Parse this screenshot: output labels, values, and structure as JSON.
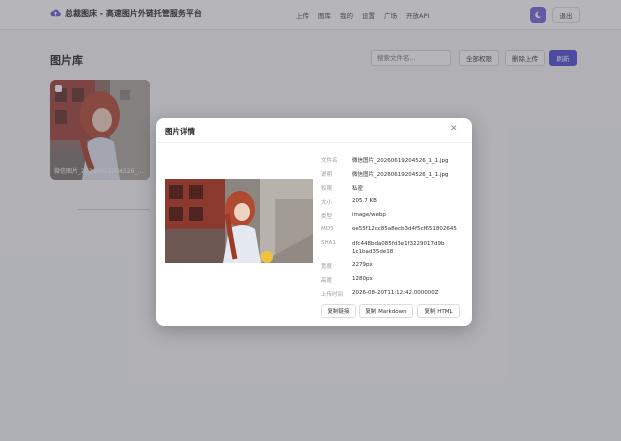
{
  "header": {
    "logo_icon": "cloud-upload-icon",
    "title": "总裁图床 - 高速图片外链托管服务平台",
    "nav": [
      "上传",
      "图库",
      "我的",
      "设置",
      "广场",
      "开放API"
    ],
    "theme_icon": "moon-icon",
    "logout_label": "退出"
  },
  "page": {
    "title": "图片库",
    "search_placeholder": "搜索文件名...",
    "select_all_label": "全部权限",
    "delete_label": "删除上传",
    "refresh_label": "刷新",
    "accent_color": "#4a47d1"
  },
  "gallery": {
    "items": [
      {
        "name": "微信图片_20260619204526_1_1.jpg"
      }
    ]
  },
  "modal": {
    "title": "图片详情",
    "close_icon": "close-icon",
    "fields": [
      {
        "label": "文件名",
        "value": "微信图片_20260619204526_1_1.jpg"
      },
      {
        "label": "说明",
        "value": "微信图片_20260619204526_1_1.jpg"
      },
      {
        "label": "权限",
        "value": "私密"
      },
      {
        "label": "大小",
        "value": "205.7 KB"
      },
      {
        "label": "类型",
        "value": "image/webp"
      },
      {
        "label": "MD5",
        "value": "ee55f12cc85a8ecb3d4f5cf651802645"
      },
      {
        "label": "SHA1",
        "value": "dfc448bda085fd3e1f3229017d9b1c1bad35de18"
      },
      {
        "label": "宽度",
        "value": "2279px"
      },
      {
        "label": "高度",
        "value": "1280px"
      },
      {
        "label": "上传时间",
        "value": "2026-08-20T11:12:42.000000Z"
      }
    ],
    "buttons": {
      "copy_link": "复制链接",
      "copy_markdown": "复制 Markdown",
      "copy_html": "复制 HTML"
    }
  }
}
